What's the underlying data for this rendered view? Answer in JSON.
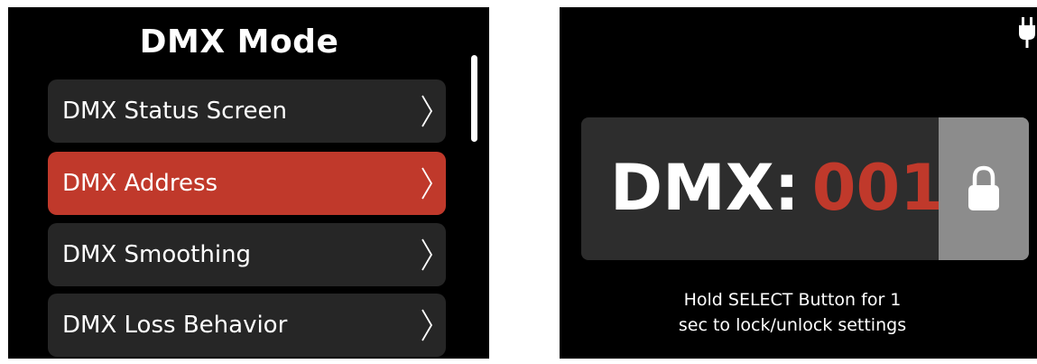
{
  "left_panel": {
    "title": "DMX Mode",
    "menu_items": [
      {
        "label": "DMX Status Screen",
        "selected": false
      },
      {
        "label": "DMX Address",
        "selected": true
      },
      {
        "label": "DMX Smoothing",
        "selected": false
      },
      {
        "label": "DMX Loss Behavior",
        "selected": false
      }
    ],
    "chevron_icon": "chevron-right-icon",
    "selected_color": "#c0392b"
  },
  "right_panel": {
    "power_icon": "plug-icon",
    "dmx_label": "DMX:",
    "dmx_value": "001",
    "lock_icon": "lock-icon",
    "hint_text": "Hold SELECT Button for 1\nsec to lock/unlock settings",
    "accent_color": "#c0392b"
  }
}
